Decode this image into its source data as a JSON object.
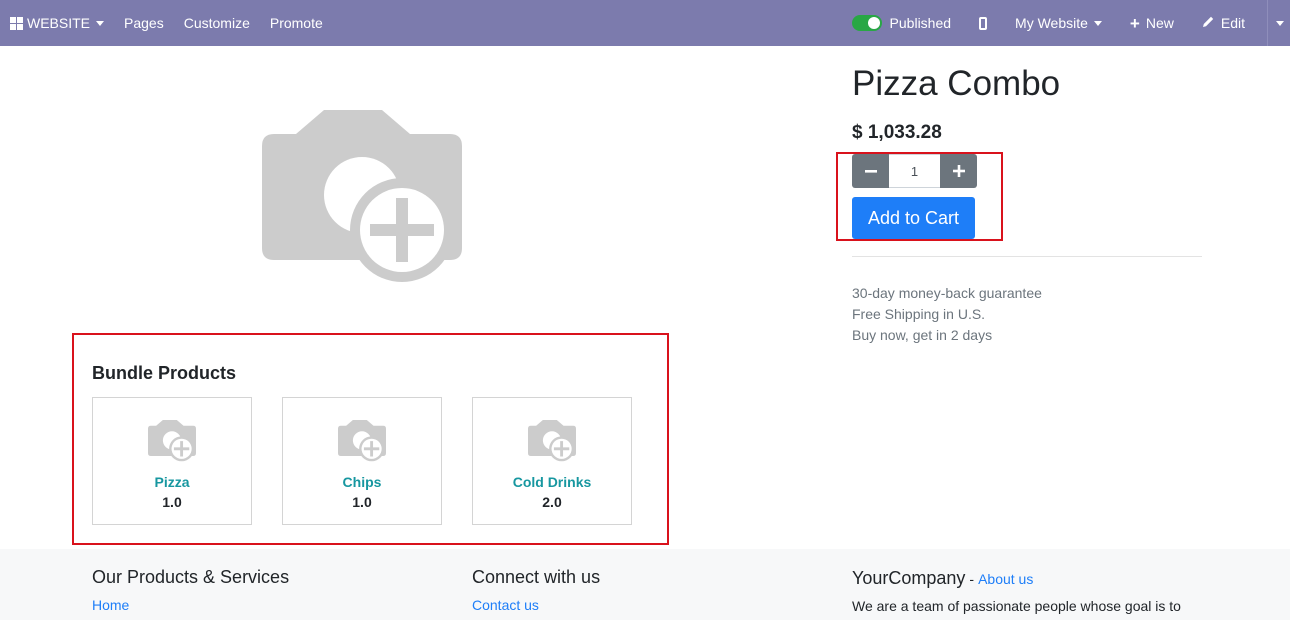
{
  "topbar": {
    "brand_label": "WEBSITE",
    "nav": [
      "Pages",
      "Customize",
      "Promote"
    ],
    "published_label": "Published",
    "website_label": "My Website",
    "new_label": "New",
    "edit_label": "Edit"
  },
  "product": {
    "name": "Pizza Combo",
    "price": "$ 1,033.28",
    "quantity": "1",
    "add_to_cart_label": "Add to Cart",
    "guarantees": [
      "30-day money-back guarantee",
      "Free Shipping in U.S.",
      "Buy now, get in 2 days"
    ]
  },
  "bundle": {
    "title": "Bundle Products",
    "items": [
      {
        "name": "Pizza",
        "qty": "1.0"
      },
      {
        "name": "Chips",
        "qty": "1.0"
      },
      {
        "name": "Cold Drinks",
        "qty": "2.0"
      }
    ]
  },
  "footer": {
    "col1_title": "Our Products & Services",
    "col1_link": "Home",
    "col2_title": "Connect with us",
    "col2_link": "Contact us",
    "company": "YourCompany",
    "separator": "-",
    "about_link": "About us",
    "tagline": "We are a team of passionate people whose goal is to"
  },
  "colors": {
    "topbar": "#7c7bad",
    "primary_button": "#1e7ef8",
    "highlight_border": "#d9121c",
    "product_link": "#1797a0"
  }
}
